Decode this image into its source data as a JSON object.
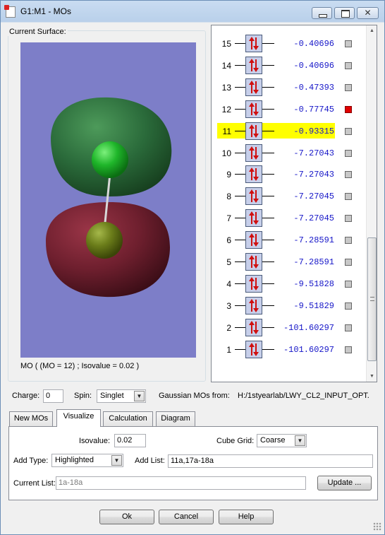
{
  "window": {
    "title": "G1:M1 - MOs",
    "close_glyph": "✕"
  },
  "surface": {
    "legend": "Current Surface:",
    "caption": "MO ( (MO = 12) ; Isovalue = 0.02 )"
  },
  "orbitals": [
    {
      "num": "15",
      "energy": "-0.40696",
      "marked": false,
      "selected": false
    },
    {
      "num": "14",
      "energy": "-0.40696",
      "marked": false,
      "selected": false
    },
    {
      "num": "13",
      "energy": "-0.47393",
      "marked": false,
      "selected": false
    },
    {
      "num": "12",
      "energy": "-0.77745",
      "marked": true,
      "selected": false
    },
    {
      "num": "11",
      "energy": "-0.93315",
      "marked": false,
      "selected": true
    },
    {
      "num": "10",
      "energy": "-7.27043",
      "marked": false,
      "selected": false
    },
    {
      "num": "9",
      "energy": "-7.27043",
      "marked": false,
      "selected": false
    },
    {
      "num": "8",
      "energy": "-7.27045",
      "marked": false,
      "selected": false
    },
    {
      "num": "7",
      "energy": "-7.27045",
      "marked": false,
      "selected": false
    },
    {
      "num": "6",
      "energy": "-7.28591",
      "marked": false,
      "selected": false
    },
    {
      "num": "5",
      "energy": "-7.28591",
      "marked": false,
      "selected": false
    },
    {
      "num": "4",
      "energy": "-9.51828",
      "marked": false,
      "selected": false
    },
    {
      "num": "3",
      "energy": "-9.51829",
      "marked": false,
      "selected": false
    },
    {
      "num": "2",
      "energy": "-101.60297",
      "marked": false,
      "selected": false
    },
    {
      "num": "1",
      "energy": "-101.60297",
      "marked": false,
      "selected": false
    }
  ],
  "colors": {
    "viewport_bg": "#7d7ec8",
    "positive_lobe": "#2a6a3a",
    "negative_lobe": "#6e1f2e",
    "atom_top": "#1fb62a",
    "atom_bottom": "#6b7d1a",
    "selected_row": "#ffff00",
    "marked_box": "#e00000",
    "energy_text": "#1515c8"
  },
  "status": {
    "charge_label": "Charge:",
    "charge_value": "0",
    "spin_label": "Spin:",
    "spin_value": "Singlet",
    "source_label": "Gaussian MOs from:",
    "source_path": "H:/1styearlab/LWY_CL2_INPUT_OPT."
  },
  "tabs": [
    "New MOs",
    "Visualize",
    "Calculation",
    "Diagram"
  ],
  "active_tab": "Visualize",
  "visualize": {
    "isovalue_label": "Isovalue:",
    "isovalue": "0.02",
    "cube_grid_label": "Cube Grid:",
    "cube_grid": "Coarse",
    "add_type_label": "Add Type:",
    "add_type": "Highlighted",
    "add_list_label": "Add List:",
    "add_list": "11a,17a-18a",
    "current_list_label": "Current List:",
    "current_list": "1a-18a",
    "update_button": "Update ..."
  },
  "footer": {
    "ok": "Ok",
    "cancel": "Cancel",
    "help": "Help"
  }
}
